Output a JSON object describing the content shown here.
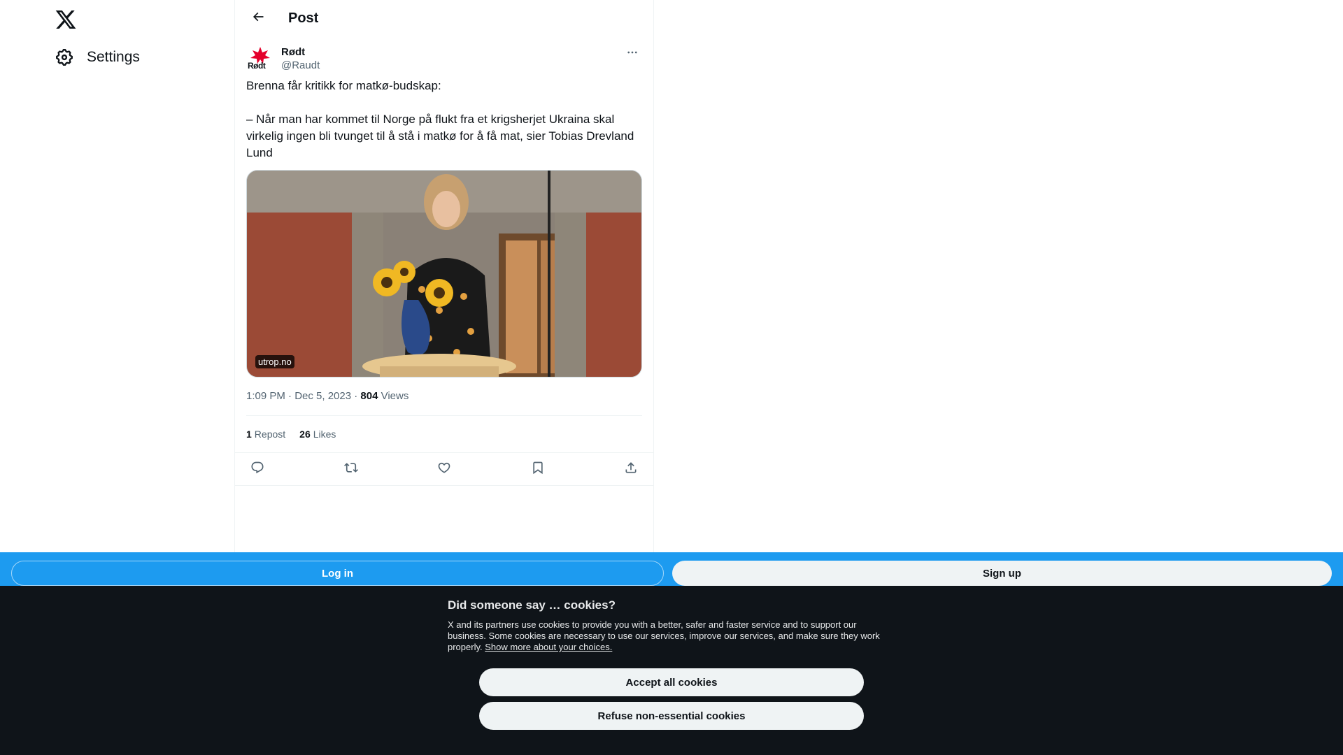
{
  "nav": {
    "logo_icon": "x-logo-icon",
    "settings_label": "Settings",
    "settings_icon": "gear-icon"
  },
  "header": {
    "title": "Post",
    "back_icon": "arrow-left-icon"
  },
  "post": {
    "author_name": "Rødt",
    "author_handle": "@Raudt",
    "avatar_text": "Rødt",
    "text": "Brenna får kritikk for matkø-budskap:\n\n– Når man har kommet til Norge på flukt fra et krigsherjet Ukraina skal virkelig ingen bli tvunget til å stå i matkø for å få mat, sier Tobias Drevland Lund",
    "media_source": "utrop.no",
    "time": "1:09 PM · Dec 5, 2023 · ",
    "views_count": "804",
    "views_label": " Views",
    "reposts_count": "1",
    "reposts_label": "Repost",
    "likes_count": "26",
    "likes_label": "Likes"
  },
  "actions": {
    "reply_icon": "reply-icon",
    "repost_icon": "repost-icon",
    "like_icon": "heart-icon",
    "bookmark_icon": "bookmark-icon",
    "share_icon": "share-icon"
  },
  "bottom_bar": {
    "login_label": "Log in",
    "signup_label": "Sign up",
    "bar_color": "#1d9bf0"
  },
  "cookie_banner": {
    "title": "Did someone say … cookies?",
    "body": "X and its partners use cookies to provide you with a better, safer and faster service and to support our business. Some cookies are necessary to use our services, improve our services, and make sure they work properly. ",
    "link": "Show more about your choices.",
    "accept_label": "Accept all cookies",
    "refuse_label": "Refuse non-essential cookies"
  },
  "colors": {
    "accent": "#1d9bf0",
    "banner_bg": "#0f1419",
    "brand_red": "#e4002b"
  }
}
